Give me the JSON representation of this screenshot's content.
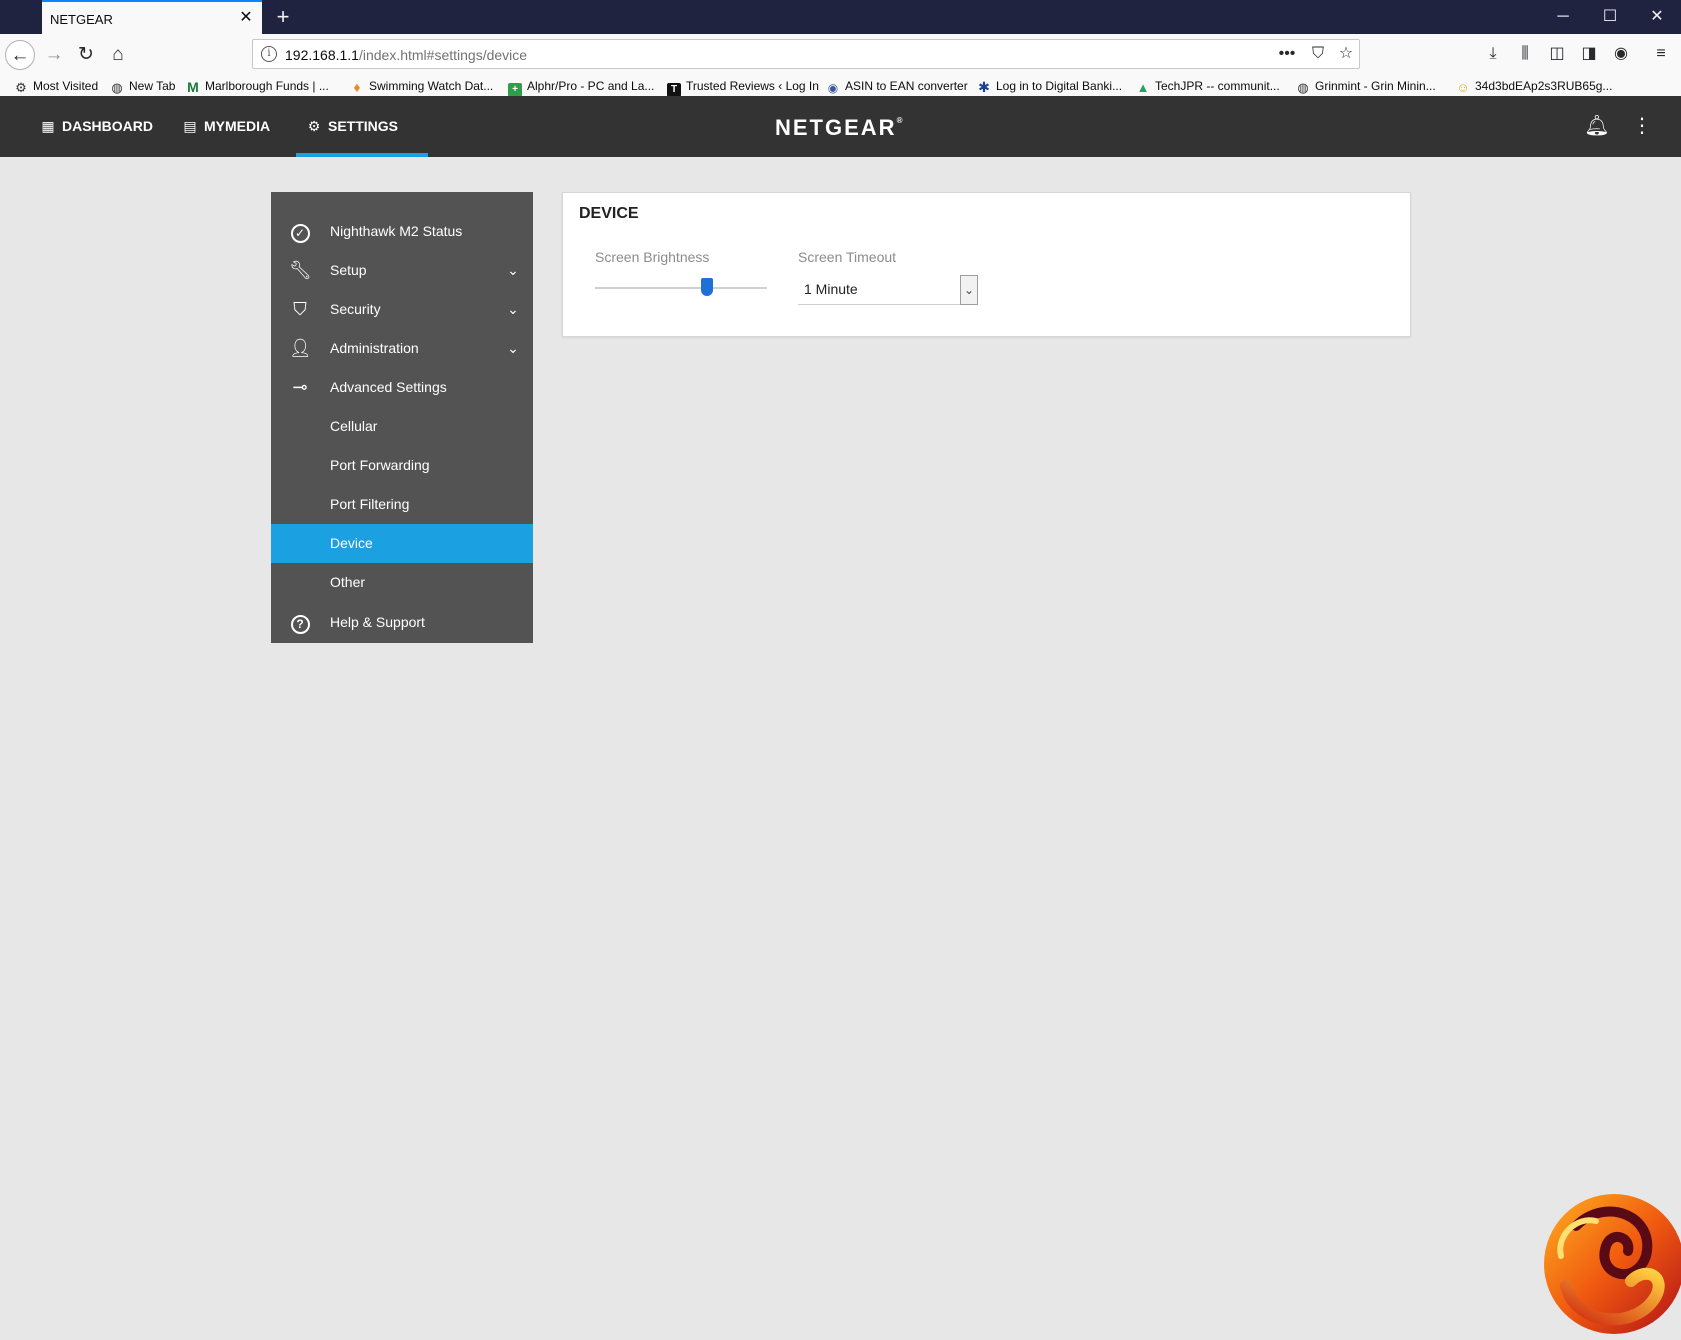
{
  "browser": {
    "tab_title": "NETGEAR",
    "tab_close": "✕",
    "new_tab": "+",
    "window_controls": {
      "minimize": "─",
      "maximize": "☐",
      "close": "✕"
    },
    "url_host": "192.168.1.1",
    "url_path": "/index.html#settings/device",
    "url_actions": {
      "more": "•••",
      "pocket": "⛉",
      "star": "☆"
    },
    "toolbar_icons": [
      "downloads-icon",
      "library-icon",
      "sidebar-icon",
      "extension-icon",
      "account-icon",
      "menu-icon"
    ],
    "bookmarks": [
      "Most Visited",
      "New Tab",
      "Marlborough Funds | ...",
      "Swimming Watch Dat...",
      "Alphr/Pro - PC and La...",
      "Trusted Reviews ‹ Log In",
      "ASIN to EAN converter",
      "Log in to Digital Banki...",
      "TechJPR -- communit...",
      "Grinmint - Grin Minin...",
      "34d3bdEAp2s3RUB65g..."
    ]
  },
  "header": {
    "tabs": [
      {
        "label": "DASHBOARD",
        "icon": "dashboard-icon"
      },
      {
        "label": "MYMEDIA",
        "icon": "media-icon"
      },
      {
        "label": "SETTINGS",
        "icon": "gear-icon"
      }
    ],
    "active_tab": "SETTINGS",
    "logo": "NETGEAR",
    "logo_mark": "®",
    "accent_color": "#1ba1e2",
    "header_color": "#333333"
  },
  "sidebar": {
    "items": [
      {
        "label": "Nighthawk M2 Status",
        "icon": "check-circle-icon"
      },
      {
        "label": "Setup",
        "icon": "wrench-icon",
        "expandable": true
      },
      {
        "label": "Security",
        "icon": "shield-icon",
        "expandable": true
      },
      {
        "label": "Administration",
        "icon": "person-icon",
        "expandable": true
      },
      {
        "label": "Advanced Settings",
        "icon": "toggle-icon"
      },
      {
        "label": "Cellular"
      },
      {
        "label": "Port Forwarding"
      },
      {
        "label": "Port Filtering"
      },
      {
        "label": "Device",
        "active": true
      },
      {
        "label": "Other"
      },
      {
        "label": "Help & Support",
        "icon": "help-circle-icon"
      }
    ]
  },
  "card": {
    "title": "DEVICE",
    "brightness_label": "Screen Brightness",
    "brightness_level": 0.65,
    "timeout_label": "Screen Timeout",
    "timeout_value": "1 Minute"
  }
}
